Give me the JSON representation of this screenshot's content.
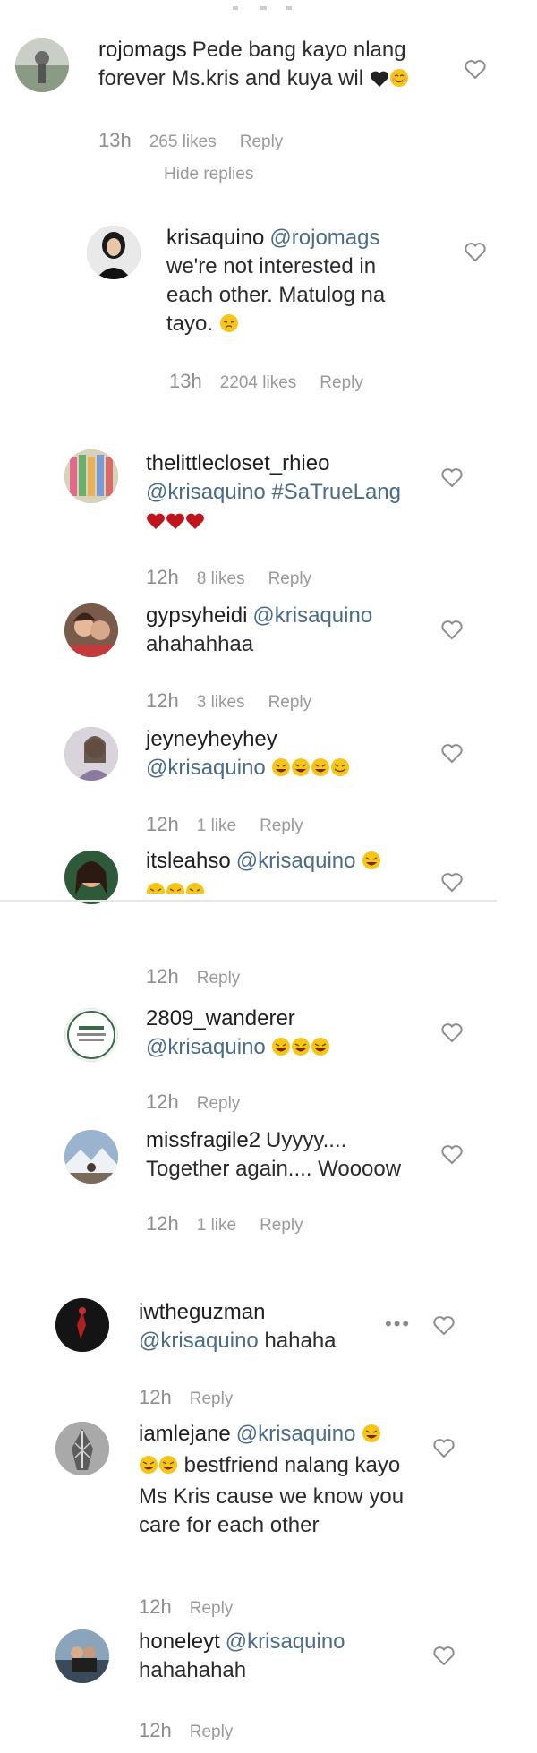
{
  "comments": [
    {
      "username": "rojomags",
      "text": "Pede bang kayo nlang forever Ms.kris and kuya wil",
      "emojis": [
        "black-heart",
        "smiling-face-with-smiling-eyes"
      ],
      "time": "13h",
      "likes": "265 likes",
      "reply": "Reply",
      "hide_replies": "Hide replies"
    },
    {
      "username": "krisaquino",
      "mention": "@rojomags",
      "text": "we're not interested in each other. Matulog na tayo.",
      "emojis": [
        "pensive-face"
      ],
      "time": "13h",
      "likes": "2204 likes",
      "reply": "Reply"
    },
    {
      "username": "thelittlecloset_rhieo",
      "mention": "@krisaquino",
      "text": "#SaTrueLang",
      "emojis": [
        "red-heart",
        "red-heart",
        "red-heart"
      ],
      "time": "12h",
      "likes": "8 likes",
      "reply": "Reply"
    },
    {
      "username": "gypsyheidi",
      "mention": "@krisaquino",
      "text": "ahahahhaa",
      "time": "12h",
      "likes": "3 likes",
      "reply": "Reply"
    },
    {
      "username": "jeyneyheyhey",
      "mention": "@krisaquino",
      "emojis": [
        "laughing-face",
        "laughing-face",
        "laughing-face",
        "laughing-face"
      ],
      "time": "12h",
      "likes": "1 like",
      "reply": "Reply"
    },
    {
      "username": "itsleahso",
      "mention": "@krisaquino",
      "emojis": [
        "laughing-face",
        "laughing-face",
        "laughing-face",
        "laughing-face"
      ],
      "time": "12h",
      "reply": "Reply"
    },
    {
      "username": "2809_wanderer",
      "mention": "@krisaquino",
      "emojis": [
        "laughing-face",
        "laughing-face",
        "laughing-face"
      ],
      "time": "12h",
      "reply": "Reply"
    },
    {
      "username": "missfragile2",
      "text": "Uyyyy.... Together again.... Woooow",
      "time": "12h",
      "likes": "1 like",
      "reply": "Reply"
    },
    {
      "username": "iwtheguzman",
      "mention": "@krisaquino",
      "text": "hahaha",
      "more": "•••",
      "time": "12h",
      "reply": "Reply"
    },
    {
      "username": "iamlejane",
      "mention": "@krisaquino",
      "text": "bestfriend nalang kayo Ms Kris cause we know you care for each other",
      "emojis": [
        "laughing-face",
        "laughing-face",
        "laughing-face"
      ],
      "time": "12h",
      "reply": "Reply"
    },
    {
      "username": "honeleyt",
      "mention": "@krisaquino",
      "text": "hahahahah",
      "time": "12h",
      "reply": "Reply"
    }
  ],
  "colors": {
    "text": "#262626",
    "meta": "#9a9a9a",
    "heart_outline": "#8e8e8e",
    "red_heart": "#c0141c",
    "emoji_yellow": "#f5c518"
  },
  "icons": [
    "heart-outline-icon",
    "more-options-icon"
  ]
}
